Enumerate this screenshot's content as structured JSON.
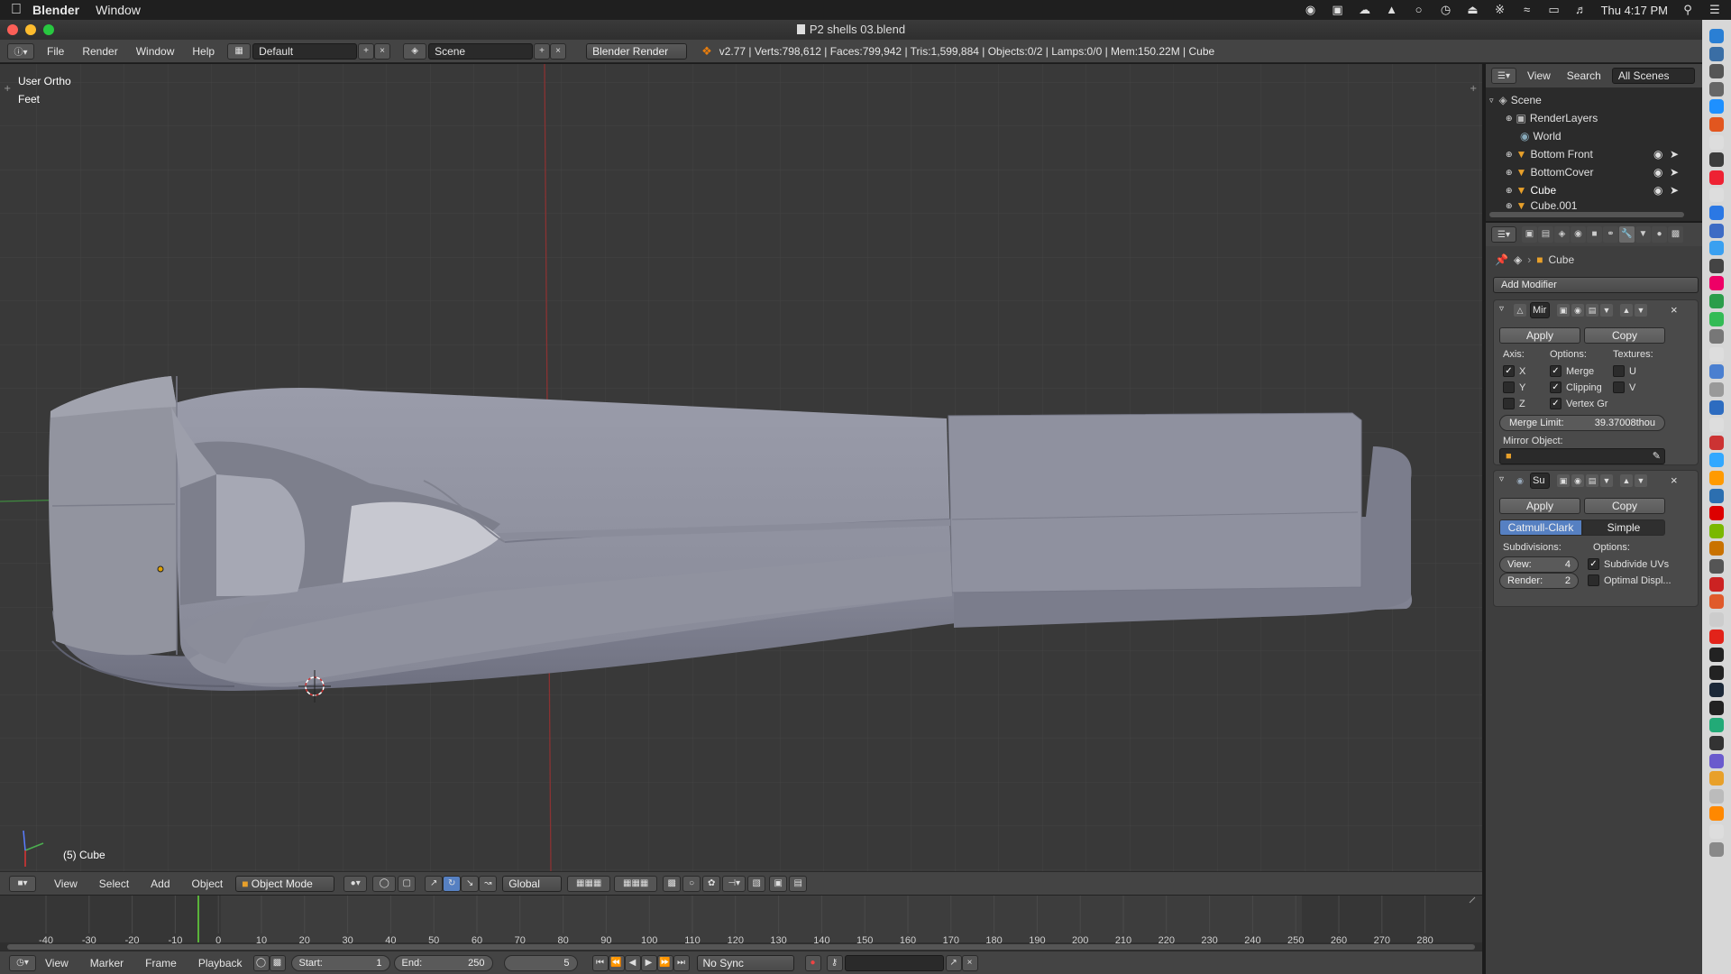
{
  "menubar": {
    "apple": "",
    "app": "Blender",
    "window": "Window",
    "clock": "Thu 4:17 PM"
  },
  "window": {
    "title": "P2 shells 03.blend"
  },
  "info_header": {
    "menus": [
      "File",
      "Render",
      "Window",
      "Help"
    ],
    "layout": "Default",
    "scene": "Scene",
    "engine": "Blender Render",
    "stats": "v2.77 | Verts:798,612 | Faces:799,942 | Tris:1,599,884 | Objects:0/2 | Lamps:0/0 | Mem:150.22M | Cube"
  },
  "viewport": {
    "view_name": "User Ortho",
    "units": "Feet",
    "active_object": "(5) Cube"
  },
  "viewport_header": {
    "menus": [
      "View",
      "Select",
      "Add",
      "Object"
    ],
    "mode": "Object Mode",
    "orientation": "Global"
  },
  "timeline": {
    "ticks": [
      "-40",
      "-30",
      "-20",
      "-10",
      "0",
      "10",
      "20",
      "30",
      "40",
      "50",
      "60",
      "70",
      "80",
      "90",
      "100",
      "110",
      "120",
      "130",
      "140",
      "150",
      "160",
      "170",
      "180",
      "190",
      "200",
      "210",
      "220",
      "230",
      "240",
      "250",
      "260",
      "270",
      "280"
    ],
    "menus": [
      "View",
      "Marker",
      "Frame",
      "Playback"
    ],
    "start_label": "Start:",
    "start": "1",
    "end_label": "End:",
    "end": "250",
    "current": "5",
    "sync": "No Sync"
  },
  "outliner": {
    "menus": [
      "View",
      "Search"
    ],
    "filter": "All Scenes",
    "items": [
      "Scene",
      "RenderLayers",
      "World",
      "Bottom Front",
      "BottomCover",
      "Cube",
      "Cube.001"
    ]
  },
  "properties": {
    "context": "Cube",
    "add_modifier": "Add Modifier",
    "mirror": {
      "name": "Mir",
      "apply": "Apply",
      "copy": "Copy",
      "axis_label": "Axis:",
      "options_label": "Options:",
      "textures_label": "Textures:",
      "axis": [
        "X",
        "Y",
        "Z"
      ],
      "options": [
        "Merge",
        "Clipping",
        "Vertex Gr"
      ],
      "textures": [
        "U",
        "V"
      ],
      "merge_limit_label": "Merge Limit:",
      "merge_limit": "39.37008thou",
      "mirror_object_label": "Mirror Object:"
    },
    "subsurf": {
      "name": "Su",
      "apply": "Apply",
      "copy": "Copy",
      "tab_catmull": "Catmull-Clark",
      "tab_simple": "Simple",
      "subdivisions_label": "Subdivisions:",
      "options_label": "Options:",
      "view_label": "View:",
      "view": "4",
      "render_label": "Render:",
      "render": "2",
      "subdivide_uvs": "Subdivide UVs",
      "optimal_display": "Optimal Displ..."
    }
  },
  "colors": {
    "accent_blue": "#5680c2",
    "grid_red": "#8a2e2e",
    "grid_green": "#3f7a3f",
    "mesh": "#8d8f9c"
  }
}
